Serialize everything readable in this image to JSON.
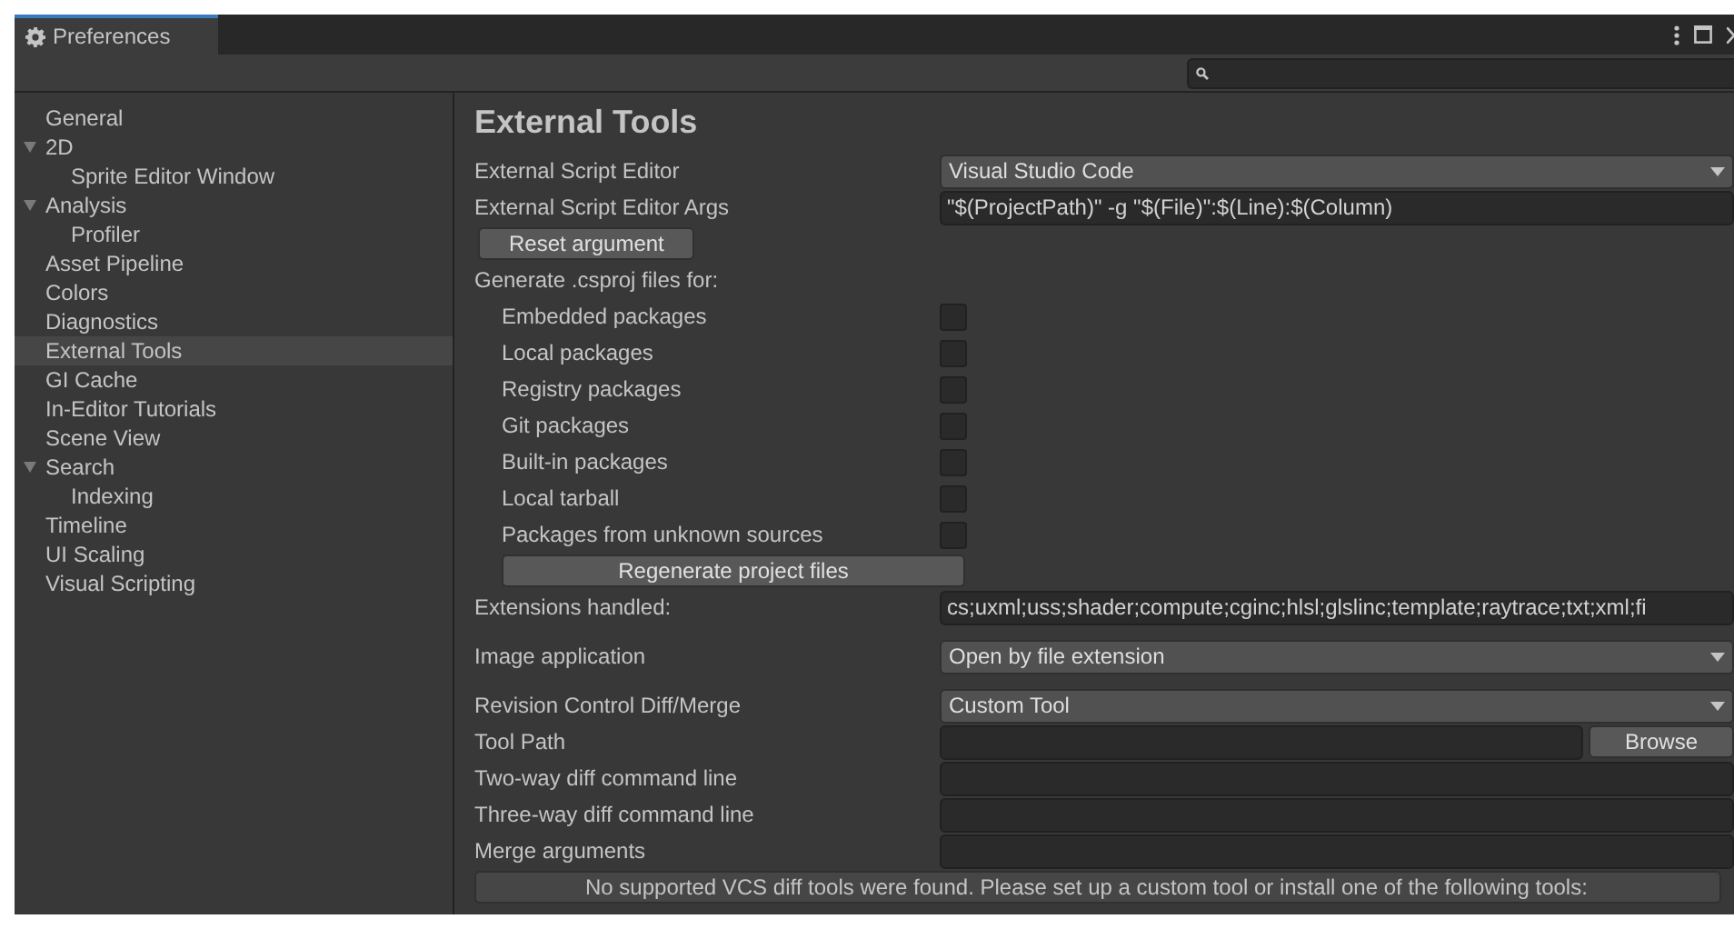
{
  "window": {
    "title": "Preferences"
  },
  "sidebar": {
    "items": [
      {
        "label": "General",
        "selected": false
      },
      {
        "label": "2D",
        "selected": false,
        "expanded": true,
        "children": [
          {
            "label": "Sprite Editor Window",
            "selected": false
          }
        ]
      },
      {
        "label": "Analysis",
        "selected": false,
        "expanded": true,
        "children": [
          {
            "label": "Profiler",
            "selected": false
          }
        ]
      },
      {
        "label": "Asset Pipeline",
        "selected": false
      },
      {
        "label": "Colors",
        "selected": false
      },
      {
        "label": "Diagnostics",
        "selected": false
      },
      {
        "label": "External Tools",
        "selected": true
      },
      {
        "label": "GI Cache",
        "selected": false
      },
      {
        "label": "In-Editor Tutorials",
        "selected": false
      },
      {
        "label": "Scene View",
        "selected": false
      },
      {
        "label": "Search",
        "selected": false,
        "expanded": true,
        "children": [
          {
            "label": "Indexing",
            "selected": false
          }
        ]
      },
      {
        "label": "Timeline",
        "selected": false
      },
      {
        "label": "UI Scaling",
        "selected": false
      },
      {
        "label": "Visual Scripting",
        "selected": false
      }
    ]
  },
  "content": {
    "title": "External Tools",
    "settings": [
      {
        "kind": "dropdown",
        "label": "External Script Editor",
        "value": "Visual Studio Code"
      },
      {
        "kind": "field",
        "label": "External Script Editor Args",
        "value": "\"$(ProjectPath)\" -g \"$(File)\":$(Line):$(Column)"
      },
      {
        "kind": "button",
        "label": "Reset argument"
      },
      {
        "kind": "label",
        "label": "Generate .csproj files for:"
      },
      {
        "kind": "checkbox",
        "label": "Embedded packages",
        "checked": false
      },
      {
        "kind": "checkbox",
        "label": "Local packages",
        "checked": false
      },
      {
        "kind": "checkbox",
        "label": "Registry packages",
        "checked": false
      },
      {
        "kind": "checkbox",
        "label": "Git packages",
        "checked": false
      },
      {
        "kind": "checkbox",
        "label": "Built-in packages",
        "checked": false
      },
      {
        "kind": "checkbox",
        "label": "Local tarball",
        "checked": false
      },
      {
        "kind": "checkbox",
        "label": "Packages from unknown sources",
        "checked": false
      },
      {
        "kind": "widebutton",
        "label": "Regenerate project files"
      },
      {
        "kind": "field",
        "label": "Extensions handled:",
        "value": "cs;uxml;uss;shader;compute;cginc;hlsl;glslinc;template;raytrace;txt;xml;fi"
      },
      {
        "kind": "dropdown",
        "label": "Image application",
        "value": "Open by file extension",
        "gap": true
      },
      {
        "kind": "dropdown",
        "label": "Revision Control Diff/Merge",
        "value": "Custom Tool",
        "gap": true
      },
      {
        "kind": "path",
        "label": "Tool Path",
        "button": "Browse"
      },
      {
        "kind": "field",
        "label": "Two-way diff command line"
      },
      {
        "kind": "field",
        "label": "Three-way diff command line"
      },
      {
        "kind": "field",
        "label": "Merge arguments"
      },
      {
        "kind": "message",
        "label": "No supported VCS diff tools were found. Please set up a custom tool or install one of the following tools:"
      }
    ]
  }
}
